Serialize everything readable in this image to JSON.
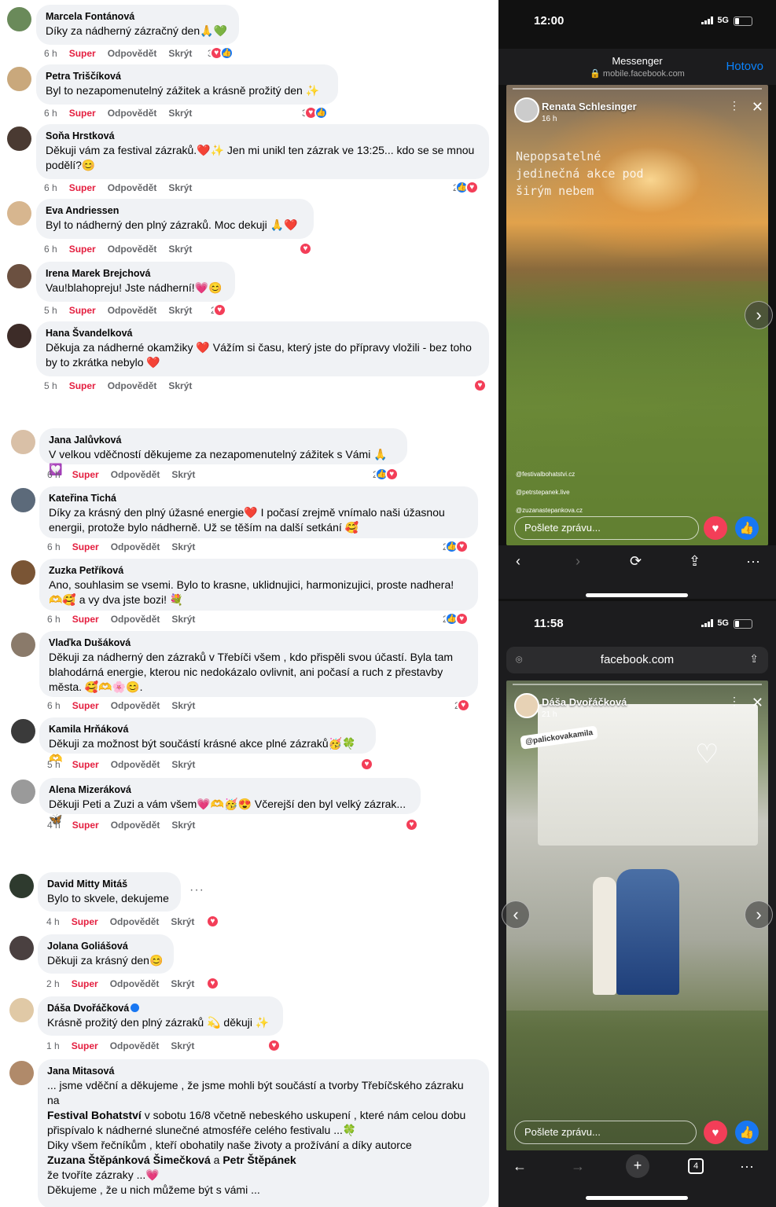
{
  "comments1": [
    {
      "name": "Marcela Fontánová",
      "text": "Díky za nádherný zázračný den🙏💚",
      "time": "6 h",
      "react_count": "3"
    },
    {
      "name": "Petra Triščíková",
      "text": "Byl to nezapomenutelný zážitek a krásně prožitý den ✨",
      "time": "6 h",
      "react_count": "3"
    },
    {
      "name": "Soňa Hrstková",
      "text": "Děkuji vám za festival zázraků.❤️✨ Jen mi unikl ten zázrak ve 13:25... kdo se se mnou podělí?😊",
      "time": "6 h",
      "react_count": "2"
    },
    {
      "name": "Eva Andriessen",
      "text": "Byl to nádherný den plný zázraků. Moc dekuji 🙏❤️",
      "time": "6 h",
      "react_count": ""
    },
    {
      "name": "Irena Marek Brejchová",
      "text": "Vau!blahopreju! Jste nádherní!💗😊",
      "time": "5 h",
      "react_count": "2"
    },
    {
      "name": "Hana Švandelková",
      "text": "Děkuja za nádherné okamžiky ❤️ Vážím si času, který jste do přípravy vložili - bez toho by to zkrátka nebylo ❤️",
      "time": "5 h",
      "react_count": ""
    }
  ],
  "comments2": [
    {
      "name": "Jana Jalůvková",
      "text": "V velkou vděčností děkujeme za nezapomenutelný zážitek s Vámi 🙏💟",
      "time": "6 h",
      "react_count": "2"
    },
    {
      "name": "Kateřina Tichá",
      "text": "Díky za krásný den plný úžasné energie❤️ I počasí zrejmě vnímalo naši úžasnou energii, protože bylo nádherně. Už se těším na další setkání 🥰",
      "time": "6 h",
      "react_count": "2"
    },
    {
      "name": "Zuzka Petříková",
      "text": "Ano, souhlasim se vsemi. Bylo to krasne, uklidnujici, harmonizujici, proste nadhera! 🫶🥰 a vy dva jste bozi! 💐",
      "time": "6 h",
      "react_count": "2"
    },
    {
      "name": "Vlaďka Dušáková",
      "text": "Děkuji za nádherný den zázraků v Třebíči všem , kdo přispěli svou účastí. Byla tam blahodárná energie, kterou nic nedokázalo ovlivnit, ani počasí a ruch z přestavby města. 🥰🫶🌸😊.",
      "time": "6 h",
      "react_count": "2"
    },
    {
      "name": "Kamila Hrňáková",
      "text": "Děkuji za možnost být součástí krásné akce plné zázraků🥳🍀🫶",
      "time": "5 h",
      "react_count": ""
    },
    {
      "name": "Alena Mizeráková",
      "text": "Děkuji Peti a Zuzi a vám všem💗🫶🥳😍 Včerejší den byl velký zázrak...🦋",
      "time": "4 h",
      "react_count": ""
    }
  ],
  "comments3": [
    {
      "name": "David Mitty Mitáš",
      "text": "Bylo to skvele, dekujeme",
      "time": "4 h"
    },
    {
      "name": "Jolana Goliášová",
      "text": "Děkuji za krásný den😊",
      "time": "2 h"
    },
    {
      "name": "Dáša Dvořáčková",
      "text": "Krásně prožitý den plný zázraků 💫 děkuji ✨",
      "time": "1 h"
    }
  ],
  "last_comment": {
    "name": "Jana Mitasová",
    "line1": "... jsme vděční a děkujeme , že jsme mohli být součástí a tvorby Třebíčského zázraku",
    "line2": "na",
    "line3_bold": "Festival Bohatství",
    "line3": " v sobotu 16/8 včetně nebeského uskupení , které nám celou dobu",
    "line4": "přispívalo k nádherné slunečné atmosféře celého festivalu ...🍀",
    "line5": "Diky všem řečníkům , kteří obohatily naše životy a prožívání a díky autorce",
    "line6_bold1": "Zuzana Štěpánková Šimečková",
    "line6_mid": " a ",
    "line6_bold2": "Petr Štěpánek",
    "line7": "že tvoříte zázraky ...💗",
    "line8": "Děkujeme , že u nich můžeme být s vámi ..."
  },
  "actions": {
    "super": "Super",
    "reply": "Odpovědět",
    "hide": "Skrýt"
  },
  "phone1": {
    "time": "12:00",
    "net": "5G",
    "header_title": "Messenger",
    "header_url": "mobile.facebook.com",
    "done": "Hotovo",
    "story_name": "Renata Schlesinger",
    "story_time": "16 h",
    "overlay1": "Nepopsatelné",
    "overlay2": "jedinečná akce pod",
    "overlay3": "širým nebem",
    "tag1": "@festivalbohatstvi.cz",
    "tag2": "@petrstepanek.live",
    "tag3": "@zuzanastepankova.cz",
    "reply": "Pošlete zprávu..."
  },
  "phone2": {
    "time": "11:58",
    "net": "5G",
    "url": "facebook.com",
    "story_name": "Dáša Dvořáčková",
    "story_time": "21 h",
    "mention": "@palickovakamila",
    "reply": "Pošlete zprávu...",
    "tabs": "4"
  }
}
